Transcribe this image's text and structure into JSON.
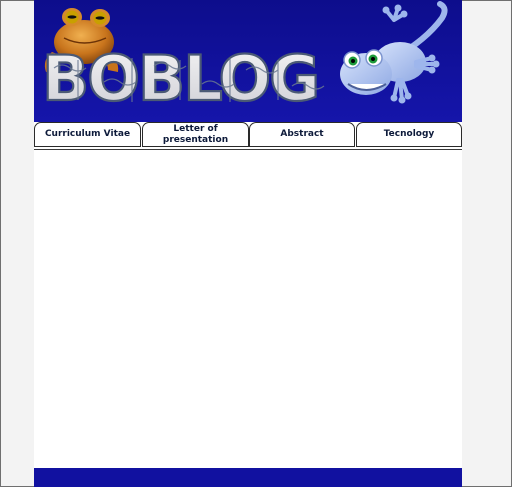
{
  "banner": {
    "logo_text": "BOBLOG"
  },
  "nav": {
    "tabs": [
      {
        "label": "Curriculum Vitae"
      },
      {
        "label": "Letter of presentation"
      },
      {
        "label": "Abstract"
      },
      {
        "label": "Tecnology"
      }
    ]
  },
  "colors": {
    "banner_bg": "#1111a0",
    "footer_bg": "#1111a0",
    "page_bg": "#ffffff",
    "outer_bg": "#f3f3f3"
  },
  "icons": [
    "frog-mascot",
    "gecko-mascot",
    "puzzle-logo"
  ]
}
